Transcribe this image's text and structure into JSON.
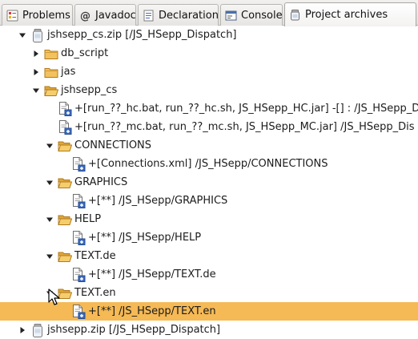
{
  "tabs": [
    {
      "label": "Problems",
      "icon": "problems-icon"
    },
    {
      "label": "Javadoc",
      "icon": "at-icon"
    },
    {
      "label": "Declaration",
      "icon": "declaration-icon"
    },
    {
      "label": "Console",
      "icon": "console-icon"
    },
    {
      "label": "Project archives",
      "icon": "jar-icon",
      "active": true
    }
  ],
  "tree": {
    "items": [
      {
        "label": "jshsepp_cs.zip [/JS_HSepp_Dispatch]",
        "icon": "zip-archive-icon",
        "twisty": "expanded"
      },
      {
        "label": "db_script",
        "icon": "folder-icon",
        "twisty": "collapsed"
      },
      {
        "label": "jas",
        "icon": "folder-icon",
        "twisty": "collapsed"
      },
      {
        "label": "jshsepp_cs",
        "icon": "folder-open-icon",
        "twisty": "expanded"
      },
      {
        "label": "+[run_??_hc.bat, run_??_hc.sh, JS_HSepp_HC.jar] -[] : /JS_HSepp_D",
        "icon": "fileset-icon",
        "twisty": "none"
      },
      {
        "label": "+[run_??_mc.bat, run_??_mc.sh, JS_HSepp_MC.jar] /JS_HSepp_Dis",
        "icon": "fileset-icon",
        "twisty": "none"
      },
      {
        "label": "CONNECTIONS",
        "icon": "folder-open-icon",
        "twisty": "expanded"
      },
      {
        "label": "+[Connections.xml] /JS_HSepp/CONNECTIONS",
        "icon": "fileset-icon",
        "twisty": "none"
      },
      {
        "label": "GRAPHICS",
        "icon": "folder-open-icon",
        "twisty": "expanded"
      },
      {
        "label": "+[**] /JS_HSepp/GRAPHICS",
        "icon": "fileset-icon",
        "twisty": "none"
      },
      {
        "label": "HELP",
        "icon": "folder-open-icon",
        "twisty": "expanded"
      },
      {
        "label": "+[**] /JS_HSepp/HELP",
        "icon": "fileset-icon",
        "twisty": "none"
      },
      {
        "label": "TEXT.de",
        "icon": "folder-open-icon",
        "twisty": "expanded"
      },
      {
        "label": "+[**] /JS_HSepp/TEXT.de",
        "icon": "fileset-icon",
        "twisty": "none"
      },
      {
        "label": "TEXT.en",
        "icon": "folder-open-icon",
        "twisty": "expanded"
      },
      {
        "label": "+[**] /JS_HSepp/TEXT.en",
        "icon": "fileset-icon",
        "twisty": "none",
        "selected": true
      },
      {
        "label": "jshsepp.zip [/JS_HSepp_Dispatch]",
        "icon": "zip-archive-icon",
        "twisty": "collapsed"
      }
    ]
  },
  "colors": {
    "selection": "#f5b955",
    "folder": "#e8a93a",
    "tab_bar": "#e6e5e3"
  }
}
